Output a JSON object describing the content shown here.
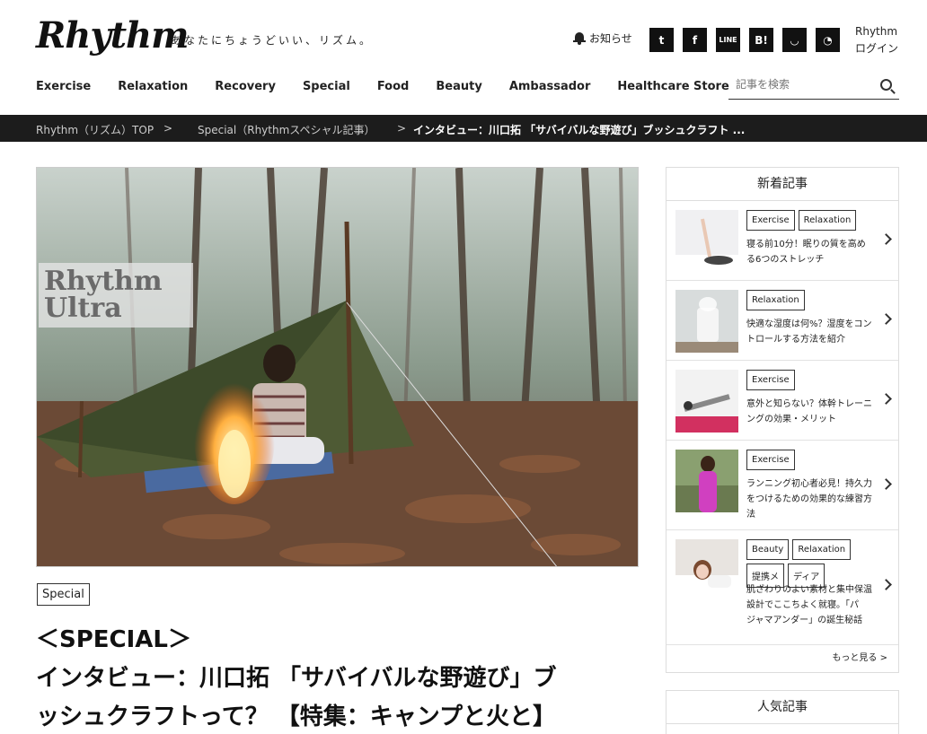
{
  "header": {
    "logo": "Rhythm",
    "tagline": "あなたにちょうどいい、リズム。",
    "notice_label": "お知らせ",
    "social": [
      {
        "icon": "twitter-icon",
        "glyph": "t"
      },
      {
        "icon": "facebook-icon",
        "glyph": "f"
      },
      {
        "icon": "line-icon",
        "glyph": "LINE"
      },
      {
        "icon": "hatena-bookmark-icon",
        "glyph": "B!"
      },
      {
        "icon": "pocket-icon",
        "glyph": "◡"
      },
      {
        "icon": "rss-icon",
        "glyph": "◔"
      }
    ],
    "login_line1": "Rhythm",
    "login_line2": "ログイン"
  },
  "nav": [
    "Exercise",
    "Relaxation",
    "Recovery",
    "Special",
    "Food",
    "Beauty",
    "Ambassador",
    "Healthcare Store"
  ],
  "search": {
    "placeholder": "記事を検索"
  },
  "breadcrumb": {
    "home": "Rhythm（リズム）TOP",
    "sep1": ">",
    "section": "Special（Rhythmスペシャル記事）",
    "sep2": ">",
    "current": "インタビュー：川口拓 「サバイバルな野遊び」ブッシュクラフト ..."
  },
  "hero": {
    "overlay_line1": "Rhythm",
    "overlay_line2": "Ultra"
  },
  "article": {
    "category": "Special",
    "title_line1": "＜SPECIAL＞",
    "title_line2": "インタビュー：川口拓 「サバイバルな野遊び」ブ",
    "title_line3": "ッシュクラフトって？ 【特集：キャンプと火と】"
  },
  "sidebar": {
    "new_title": "新着記事",
    "items": [
      {
        "tags": [
          "Exercise",
          "Relaxation"
        ],
        "text": [
          "寝る前10分！眠りの質を高め",
          "る6つのストレッチ"
        ]
      },
      {
        "tags": [
          "Relaxation"
        ],
        "text": [
          "快適な湿度は何%？湿度をコン",
          "トロールする方法を紹介"
        ]
      },
      {
        "tags": [
          "Exercise"
        ],
        "text": [
          "意外と知らない？体幹トレーニ",
          "ングの効果・メリット"
        ]
      },
      {
        "tags": [
          "Exercise"
        ],
        "text": [
          "ランニング初心者必見！持久力",
          "をつけるための効果的な練習方",
          "法"
        ]
      },
      {
        "tags": [
          "Beauty",
          "Relaxation",
          "提携メ",
          "ディア"
        ],
        "text": [
          "肌ざわりのよい素材と集中保温",
          "設計でここちよく就寝。「パ",
          "ジャマアンダー」の誕生秘話"
        ]
      }
    ],
    "more_label": "もっと見る >",
    "popular_title": "人気記事"
  }
}
